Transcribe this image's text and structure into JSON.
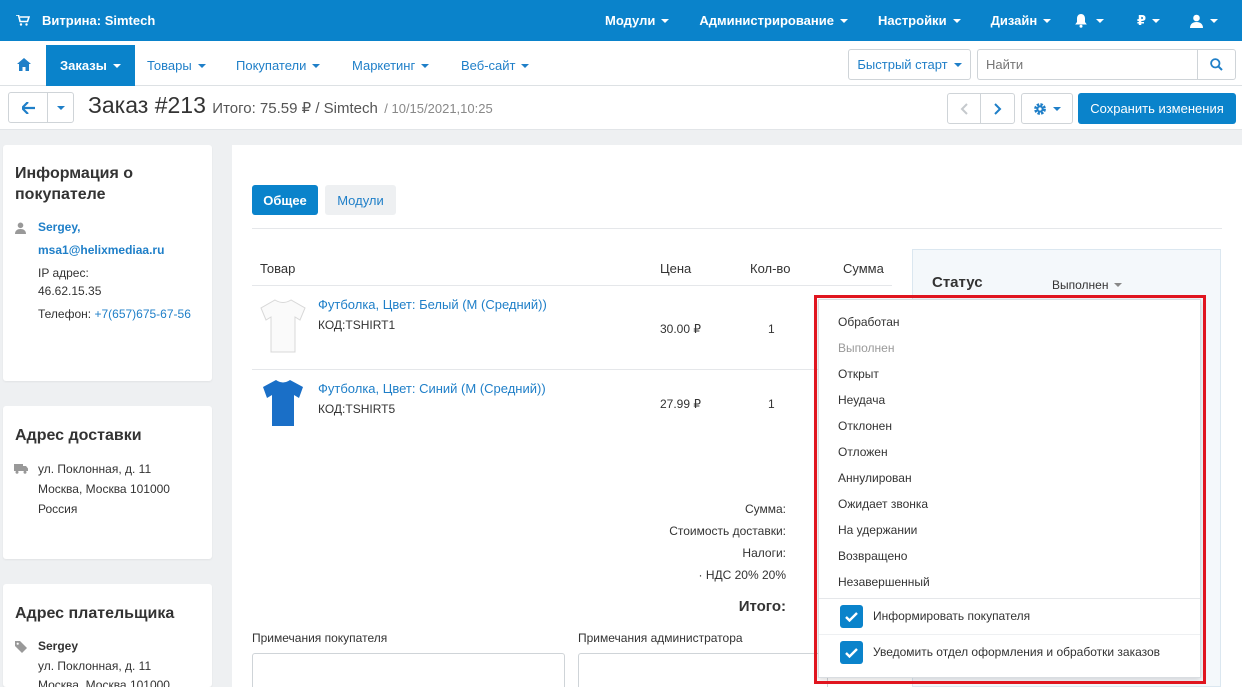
{
  "topbar": {
    "store_label": "Витрина: Simtech",
    "menu": [
      "Модули",
      "Администрирование",
      "Настройки",
      "Дизайн"
    ],
    "currency": "₽",
    "colors": {
      "primary": "#0a83cb",
      "highlight": "#e0151f"
    }
  },
  "navbar": {
    "home_icon": "home-icon",
    "items": [
      "Заказы",
      "Товары",
      "Покупатели",
      "Маркетинг",
      "Веб-сайт"
    ],
    "quick_start": "Быстрый старт",
    "search_placeholder": "Найти"
  },
  "titlebar": {
    "title": "Заказ #213",
    "subtitle": "Итого: 75.59 ₽ / Simtech",
    "date": "/ 10/15/2021,10:25",
    "save_label": "Сохранить изменения"
  },
  "customer": {
    "heading": "Информация о покупателе",
    "name": "Sergey,",
    "email": "msa1@helixmediaa.ru",
    "ip_label": "IP адрес:",
    "ip": "46.62.15.35",
    "phone_label": "Телефон:",
    "phone": "+7(657)675-67-56"
  },
  "shipping": {
    "heading": "Адрес доставки",
    "line1": "ул. Поклонная, д. 11",
    "line2": "Москва, Москва 101000",
    "line3": "Россия"
  },
  "billing": {
    "heading": "Адрес плательщика",
    "name": "Sergey",
    "line1": "ул. Поклонная, д. 11",
    "line2": "Москва, Москва 101000"
  },
  "tabs": [
    "Общее",
    "Модули"
  ],
  "table": {
    "headers": [
      "Товар",
      "Цена",
      "Кол-во",
      "Сумма"
    ],
    "rows": [
      {
        "name": "Футболка, Цвет: Белый (M (Средний))",
        "code": "КОД:TSHIRT1",
        "price": "30.00 ₽",
        "qty": "1",
        "color": "#ffffff"
      },
      {
        "name": "Футболка, Цвет: Синий (M (Средний))",
        "code": "КОД:TSHIRT5",
        "price": "27.99 ₽",
        "qty": "1",
        "color": "#1a6fc7"
      }
    ]
  },
  "totals": {
    "subtotal_label": "Сумма:",
    "shipping_label": "Стоимость доставки:",
    "taxes_label": "Налоги:",
    "vat_label": "· НДС 20% 20%",
    "total_label": "Итого:"
  },
  "notes": {
    "customer_label": "Примечания покупателя",
    "admin_label": "Примечания администратора"
  },
  "status": {
    "label": "Статус",
    "current": "Выполнен",
    "options": [
      {
        "label": "Обработан",
        "disabled": false
      },
      {
        "label": "Выполнен",
        "disabled": true
      },
      {
        "label": "Открыт",
        "disabled": false
      },
      {
        "label": "Неудача",
        "disabled": false
      },
      {
        "label": "Отклонен",
        "disabled": false
      },
      {
        "label": "Отложен",
        "disabled": false
      },
      {
        "label": "Аннулирован",
        "disabled": false
      },
      {
        "label": "Ожидает звонка",
        "disabled": false
      },
      {
        "label": "На удержании",
        "disabled": false
      },
      {
        "label": "Возвращено",
        "disabled": false
      },
      {
        "label": "Незавершенный",
        "disabled": false
      }
    ],
    "notify_customer": "Информировать покупателя",
    "notify_department": "Уведомить отдел оформления и обработки заказов"
  }
}
